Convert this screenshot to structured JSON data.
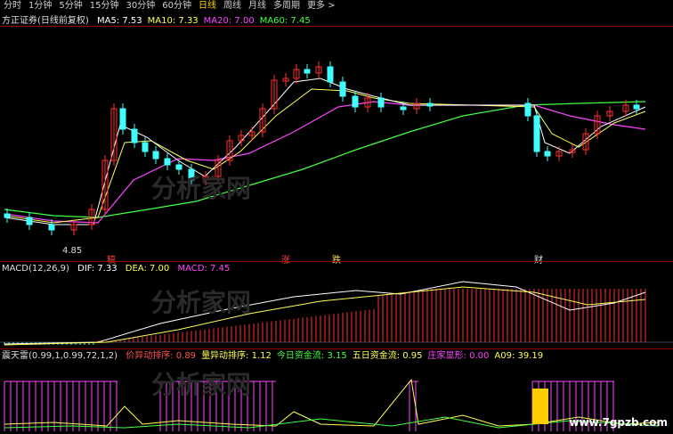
{
  "tabs": [
    "分时",
    "1分钟",
    "5分钟",
    "15分钟",
    "30分钟",
    "60分钟",
    "日线",
    "周线",
    "月线",
    "多周期",
    "更多"
  ],
  "active_tab": "日线",
  "price_panel": {
    "stock_name": "方正证券(日线前复权)",
    "ma_values": [
      {
        "label": "MA5: 7.53",
        "color": "#ffffff"
      },
      {
        "label": "MA10: 7.33",
        "color": "#ffff55"
      },
      {
        "label": "MA20: 7.00",
        "color": "#ff44ff"
      },
      {
        "label": "MA60: 7.45",
        "color": "#44ff44"
      }
    ],
    "low_label": "4.85",
    "markers": [
      "稿",
      "涨",
      "跌",
      "财"
    ]
  },
  "macd_panel": {
    "name": "MACD(12,26,9)",
    "dif": "DIF: 7.33",
    "dea": "DEA: 7.00",
    "macd": "MACD: 7.45"
  },
  "indicator_panel": {
    "name": "震天雷(0.99,1,0.99,72,1,2)",
    "values": [
      {
        "label": "价异动排序: 0.89",
        "color": "#ff5555"
      },
      {
        "label": "量异动排序: 1.12",
        "color": "#ffff55"
      },
      {
        "label": "今日资金流: 3.15",
        "color": "#44ff44"
      },
      {
        "label": "五日资金流: 0.95",
        "color": "#ffff55"
      },
      {
        "label": "庄家显形: 0.00",
        "color": "#ff44ff"
      },
      {
        "label": "A09: 39.19",
        "color": "#ffff55"
      }
    ]
  },
  "watermark": "分析家网",
  "site": "www.7gpzb.com",
  "colors": {
    "up": "#ff3030",
    "down": "#40ffff",
    "ma5": "#ffffff",
    "ma10": "#ffff55",
    "ma20": "#ff44ff",
    "ma60": "#44ff44"
  }
}
